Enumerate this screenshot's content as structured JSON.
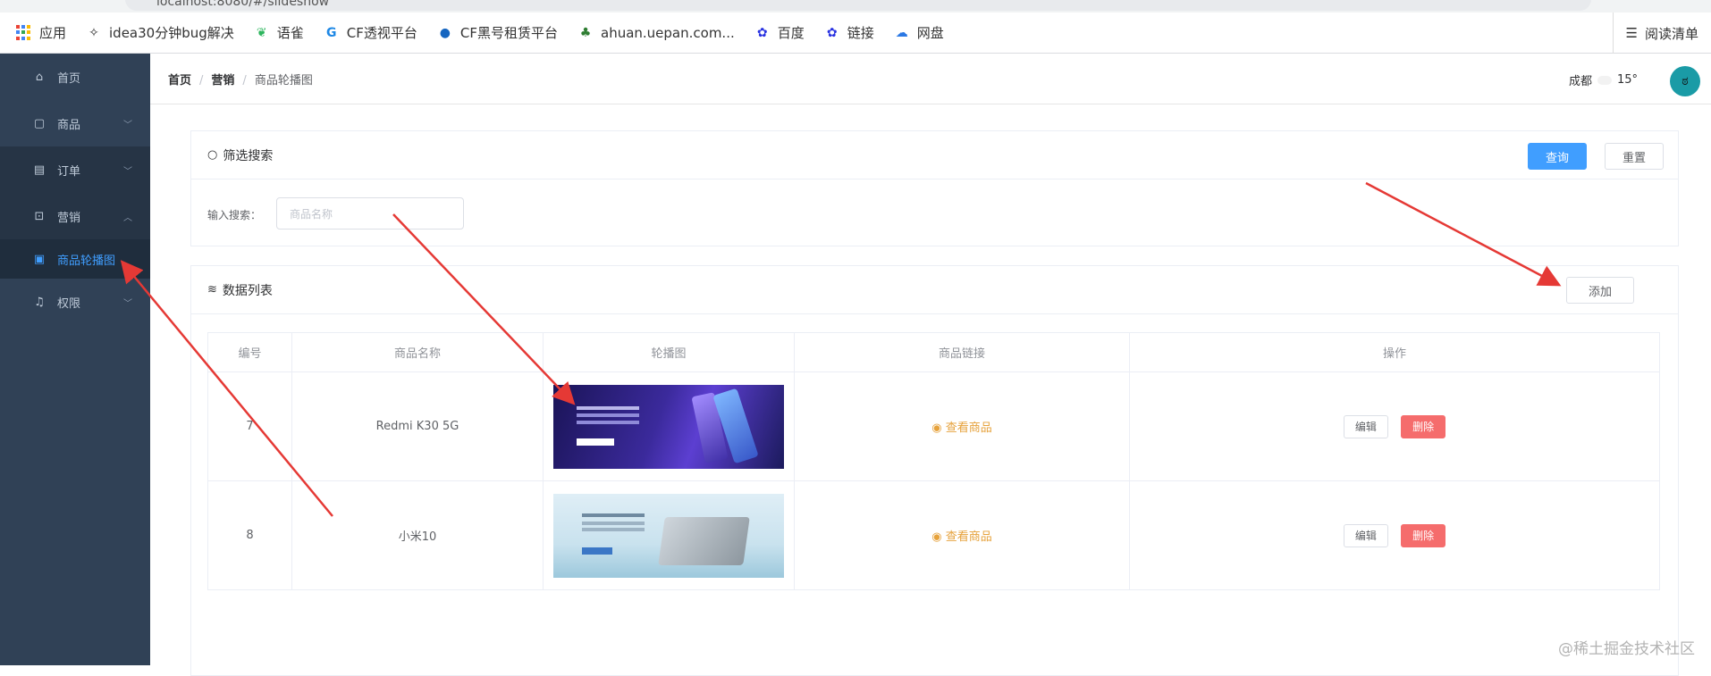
{
  "browser": {
    "url": "localhost:8080/#/slideshow",
    "bookmarks": [
      "应用",
      "idea30分钟bug解决",
      "语雀",
      "CF透视平台",
      "CF黑号租赁平台",
      "ahuan.uepan.com...",
      "百度",
      "链接",
      "网盘"
    ],
    "reading_list": "阅读清单"
  },
  "sidebar": {
    "items": [
      {
        "label": "首页",
        "icon": "home-icon"
      },
      {
        "label": "商品",
        "icon": "bag-icon"
      },
      {
        "label": "订单",
        "icon": "clipboard-icon"
      },
      {
        "label": "营销",
        "icon": "gift-icon"
      },
      {
        "label": "商品轮播图",
        "icon": "image-icon"
      },
      {
        "label": "权限",
        "icon": "bell-icon"
      }
    ]
  },
  "navbar": {
    "breadcrumb": [
      "首页",
      "营销",
      "商品轮播图"
    ],
    "city": "成都",
    "temperature": "15°"
  },
  "filter": {
    "title": "筛选搜索",
    "query_button": "查询",
    "reset_button": "重置",
    "label": "输入搜索：",
    "placeholder": "商品名称"
  },
  "list": {
    "title": "数据列表",
    "add_button": "添加",
    "columns": [
      "编号",
      "商品名称",
      "轮播图",
      "商品链接",
      "操作"
    ],
    "rows": [
      {
        "id": "7",
        "name": "Redmi K30 5G",
        "link_text": "查看商品",
        "edit": "编辑",
        "delete": "删除"
      },
      {
        "id": "8",
        "name": "小米10",
        "link_text": "查看商品",
        "edit": "编辑",
        "delete": "删除"
      }
    ]
  },
  "watermark": "@稀土掘金技术社区",
  "colors": {
    "primary": "#409eff",
    "danger": "#f56c6c",
    "warning": "#e6a23c",
    "sidebar": "#304156",
    "arrow": "#e53935"
  }
}
